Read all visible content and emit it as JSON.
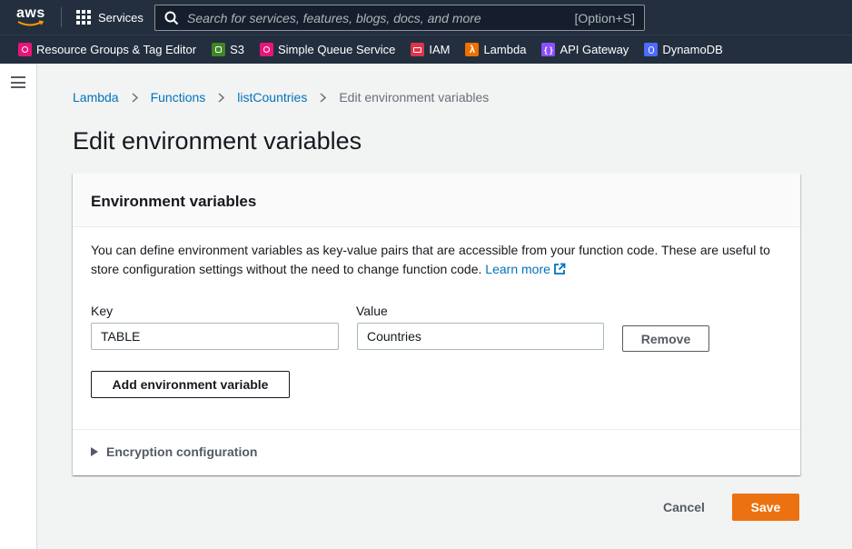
{
  "topnav": {
    "logo_text": "aws",
    "services_label": "Services",
    "search_placeholder": "Search for services, features, blogs, docs, and more",
    "search_shortcut": "[Option+S]"
  },
  "favorites": [
    {
      "label": "Resource Groups & Tag Editor",
      "color": "#e7157b",
      "icon": "resource-groups-icon"
    },
    {
      "label": "S3",
      "color": "#3f8624",
      "icon": "s3-icon"
    },
    {
      "label": "Simple Queue Service",
      "color": "#e7157b",
      "icon": "sqs-icon"
    },
    {
      "label": "IAM",
      "color": "#dd344c",
      "icon": "iam-icon"
    },
    {
      "label": "Lambda",
      "color": "#ed7100",
      "icon": "lambda-icon"
    },
    {
      "label": "API Gateway",
      "color": "#8c4fff",
      "icon": "api-gateway-icon"
    },
    {
      "label": "DynamoDB",
      "color": "#4d6bfe",
      "icon": "dynamodb-icon"
    }
  ],
  "breadcrumb": {
    "items": [
      "Lambda",
      "Functions",
      "listCountries"
    ],
    "current": "Edit environment variables"
  },
  "page": {
    "title": "Edit environment variables"
  },
  "panel": {
    "title": "Environment variables",
    "description": "You can define environment variables as key-value pairs that are accessible from your function code. These are useful to store configuration settings without the need to change function code.",
    "learn_more": "Learn more",
    "key_label": "Key",
    "value_label": "Value",
    "variables": [
      {
        "key": "TABLE",
        "value": "Countries"
      }
    ],
    "remove_label": "Remove",
    "add_label": "Add environment variable",
    "encryption_label": "Encryption configuration"
  },
  "actions": {
    "cancel_label": "Cancel",
    "save_label": "Save"
  },
  "colors": {
    "nav_bg": "#232f3e",
    "link": "#0073bb",
    "primary": "#ec7211"
  }
}
